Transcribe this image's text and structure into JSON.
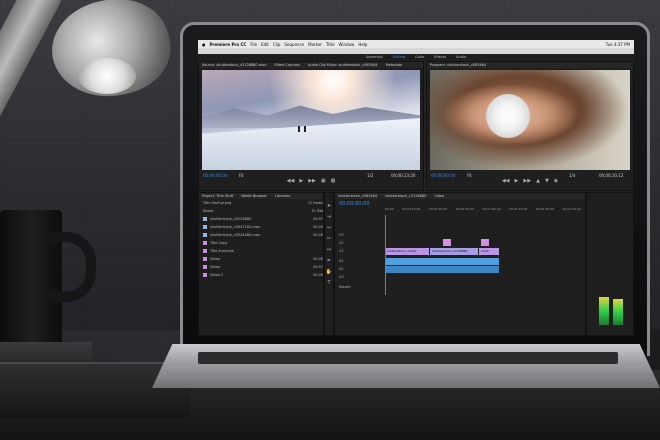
{
  "menubar": {
    "app": "Premiere Pro CC",
    "items": [
      "File",
      "Edit",
      "Clip",
      "Sequence",
      "Marker",
      "Title",
      "Window",
      "Help"
    ],
    "clock": "Tue 4:37 PM"
  },
  "workspaces": [
    "Assembly",
    "Editing",
    "Color",
    "Effects",
    "Audio"
  ],
  "source_monitor": {
    "tabs": [
      "Source: shutterstock_v3126880.mov",
      "Effect Controls",
      "Audio Clip Mixer: shutterstock_v563464",
      "Metadata"
    ],
    "timecode_in": "00;00;00;00",
    "timecode_out": "00;00;13;20",
    "fit": "Fit",
    "fraction": "1/2"
  },
  "program_monitor": {
    "title": "Program: shutterstock_v563464",
    "timecode_in": "00:00:00:00",
    "timecode_out": "00;00;10;12",
    "fit": "Fit",
    "fraction": "1/4"
  },
  "project": {
    "tabs": [
      "Project: Title Stuff",
      "Media Browser",
      "Libraries"
    ],
    "file": "Title Stuff.prproj",
    "item_count": "12 items",
    "columns": [
      "Name",
      "Fr. Rat"
    ],
    "items": [
      {
        "name": "shutterstock_v3126880",
        "rate": "29.97",
        "color": "#8fb7e8"
      },
      {
        "name": "shutterstock_v3047182.mov",
        "rate": "30.00",
        "color": "#8fb7e8"
      },
      {
        "name": "shutterstock_v5344480.mov",
        "rate": "30.00",
        "color": "#8fb7e8"
      },
      {
        "name": "Title Copy",
        "rate": "",
        "color": "#c88ee0"
      },
      {
        "name": "Title Example",
        "rate": "",
        "color": "#c88ee0"
      },
      {
        "name": "Video",
        "rate": "30.00",
        "color": "#c88ee0"
      },
      {
        "name": "Video",
        "rate": "29.97",
        "color": "#c88ee0"
      },
      {
        "name": "Video 2",
        "rate": "30.00",
        "color": "#c88ee0"
      }
    ]
  },
  "timeline": {
    "tabs": [
      "shutterstock_v563464",
      "shutterstock_v3126880",
      "Video"
    ],
    "timecode": "00:00:00:00",
    "ruler": [
      "00:00",
      "00:00:15:00",
      "00:00:30:00",
      "00:00:45:00",
      "00:01:00:00",
      "00:01:15:00",
      "00:01:30:00",
      "00:01:45:00"
    ],
    "tracks": [
      "V3",
      "V2",
      "V1",
      "A1",
      "A2",
      "A3",
      "Master"
    ],
    "clips_v1": [
      "shutterstock_v3047",
      "shutterstock_v3126880",
      "shutt"
    ]
  }
}
